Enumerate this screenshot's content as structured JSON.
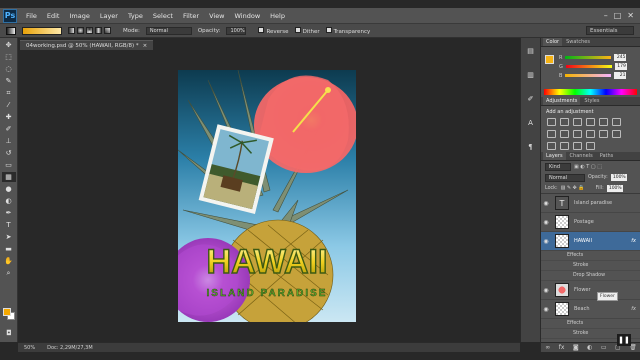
{
  "app": {
    "logo": "Ps"
  },
  "menu": [
    "File",
    "Edit",
    "Image",
    "Layer",
    "Type",
    "Select",
    "Filter",
    "View",
    "Window",
    "Help"
  ],
  "window_controls": [
    "–",
    "□",
    "✕"
  ],
  "options": {
    "mode_label": "Mode:",
    "mode_value": "Normal",
    "opacity_label": "Opacity:",
    "opacity_value": "100%",
    "reverse_label": "Reverse",
    "dither_label": "Dither",
    "transparency_label": "Transparency",
    "workspace": "Essentials"
  },
  "document": {
    "tab_title": "04working.psd @ 50% (HAWAII, RGB/8) *",
    "close": "×",
    "poster_title": "HAWAII",
    "poster_subtitle": "ISLAND PARADISE"
  },
  "status": {
    "zoom": "50%",
    "doc_size": "Doc: 2,29M/27,3M"
  },
  "color_panel": {
    "tabs": [
      "Color",
      "Swatches"
    ],
    "channels": [
      {
        "name": "R",
        "value": "245"
      },
      {
        "name": "G",
        "value": "179"
      },
      {
        "name": "B",
        "value": "21"
      }
    ],
    "fg_color": "#f5b315"
  },
  "adjustments_panel": {
    "tabs": [
      "Adjustments",
      "Styles"
    ],
    "heading": "Add an adjustment"
  },
  "layers_panel": {
    "tabs": [
      "Layers",
      "Channels",
      "Paths"
    ],
    "filter_value": "Kind",
    "blend_mode": "Normal",
    "opacity_label": "Opacity:",
    "opacity_value": "100%",
    "lock_label": "Lock:",
    "fill_label": "Fill:",
    "fill_value": "100%",
    "layers": [
      {
        "name": "Island paradise",
        "type": "text"
      },
      {
        "name": "Postage",
        "type": "image"
      },
      {
        "name": "HAWAII",
        "type": "text",
        "selected": true,
        "effects": [
          "Effects",
          "Stroke",
          "Drop Shadow"
        ]
      },
      {
        "name": "Flower",
        "type": "image"
      },
      {
        "name": "Beach",
        "type": "image",
        "effects": [
          "Effects",
          "Stroke"
        ]
      }
    ],
    "tooltip": "Flower"
  }
}
